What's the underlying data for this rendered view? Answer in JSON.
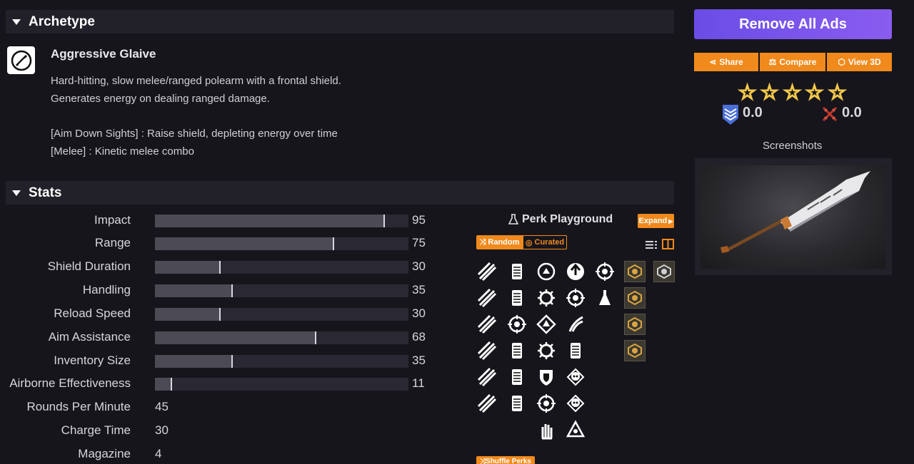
{
  "archetype": {
    "header": "Archetype",
    "name": "Aggressive Glaive",
    "desc_lines": [
      "Hard-hitting, slow melee/ranged polearm with a frontal shield.",
      "Generates energy on dealing ranged damage.",
      "[Aim Down Sights] : Raise shield, depleting energy over time",
      "[Melee] : Kinetic melee combo"
    ]
  },
  "stats": {
    "header": "Stats",
    "bars": [
      {
        "label": "Impact",
        "value": 95
      },
      {
        "label": "Range",
        "value": 75
      },
      {
        "label": "Shield Duration",
        "value": 30
      },
      {
        "label": "Handling",
        "value": 35
      },
      {
        "label": "Reload Speed",
        "value": 30
      },
      {
        "label": "Aim Assistance",
        "value": 68
      },
      {
        "label": "Inventory Size",
        "value": 35
      },
      {
        "label": "Airborne Effectiveness",
        "value": 11
      }
    ],
    "plain": [
      {
        "label": "Rounds Per Minute",
        "value": "45"
      },
      {
        "label": "Charge Time",
        "value": "30"
      },
      {
        "label": "Magazine",
        "value": "4"
      }
    ]
  },
  "perks": {
    "title": "Perk Playground",
    "expand": "Expand",
    "random": "Random",
    "curated": "Curated",
    "shuffle": "Shuffle Perks"
  },
  "sidebar": {
    "remove_ads": "Remove All Ads",
    "share": "Share",
    "compare": "Compare",
    "view3d": "View 3D",
    "rating_community": "0.0",
    "rating_other": "0.0",
    "screenshots_label": "Screenshots"
  },
  "colors": {
    "accent": "#f08a1c",
    "remove_ads": "#7a55eb",
    "star": "#f2c84b"
  }
}
